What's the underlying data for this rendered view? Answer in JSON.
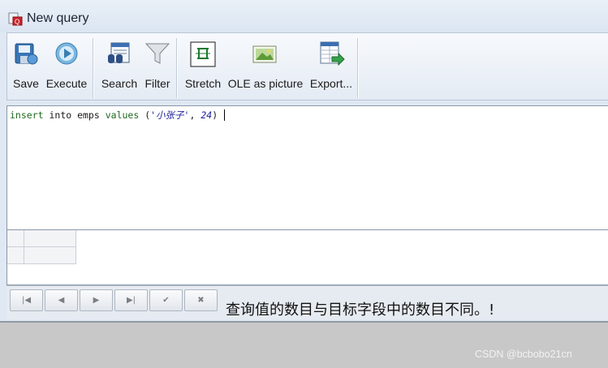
{
  "window": {
    "title": "New query"
  },
  "toolbar": {
    "buttons": [
      {
        "label": "Save",
        "icon": "save-icon"
      },
      {
        "label": "Execute",
        "icon": "execute-icon"
      },
      {
        "label": "Search",
        "icon": "search-icon"
      },
      {
        "label": "Filter",
        "icon": "filter-icon"
      },
      {
        "label": "Stretch",
        "icon": "stretch-icon"
      },
      {
        "label": "OLE as picture",
        "icon": "ole-picture-icon"
      },
      {
        "label": "Export...",
        "icon": "export-icon"
      }
    ]
  },
  "editor": {
    "tokens": {
      "t1": "insert",
      "t2": " into emps ",
      "t3": "values",
      "t4": " (",
      "t5": "'小张子'",
      "t6": ", ",
      "t7": "24",
      "t8": ")"
    }
  },
  "navigator": {
    "buttons": [
      {
        "name": "first-record",
        "glyph": "|◀"
      },
      {
        "name": "prior-record",
        "glyph": "◀"
      },
      {
        "name": "next-record",
        "glyph": "▶"
      },
      {
        "name": "last-record",
        "glyph": "▶|"
      },
      {
        "name": "post-edit",
        "glyph": "✔"
      },
      {
        "name": "cancel-edit",
        "glyph": "✖"
      }
    ],
    "message": "查询值的数目与目标字段中的数目不同。!"
  },
  "watermark": "CSDN @bcbobo21cn"
}
